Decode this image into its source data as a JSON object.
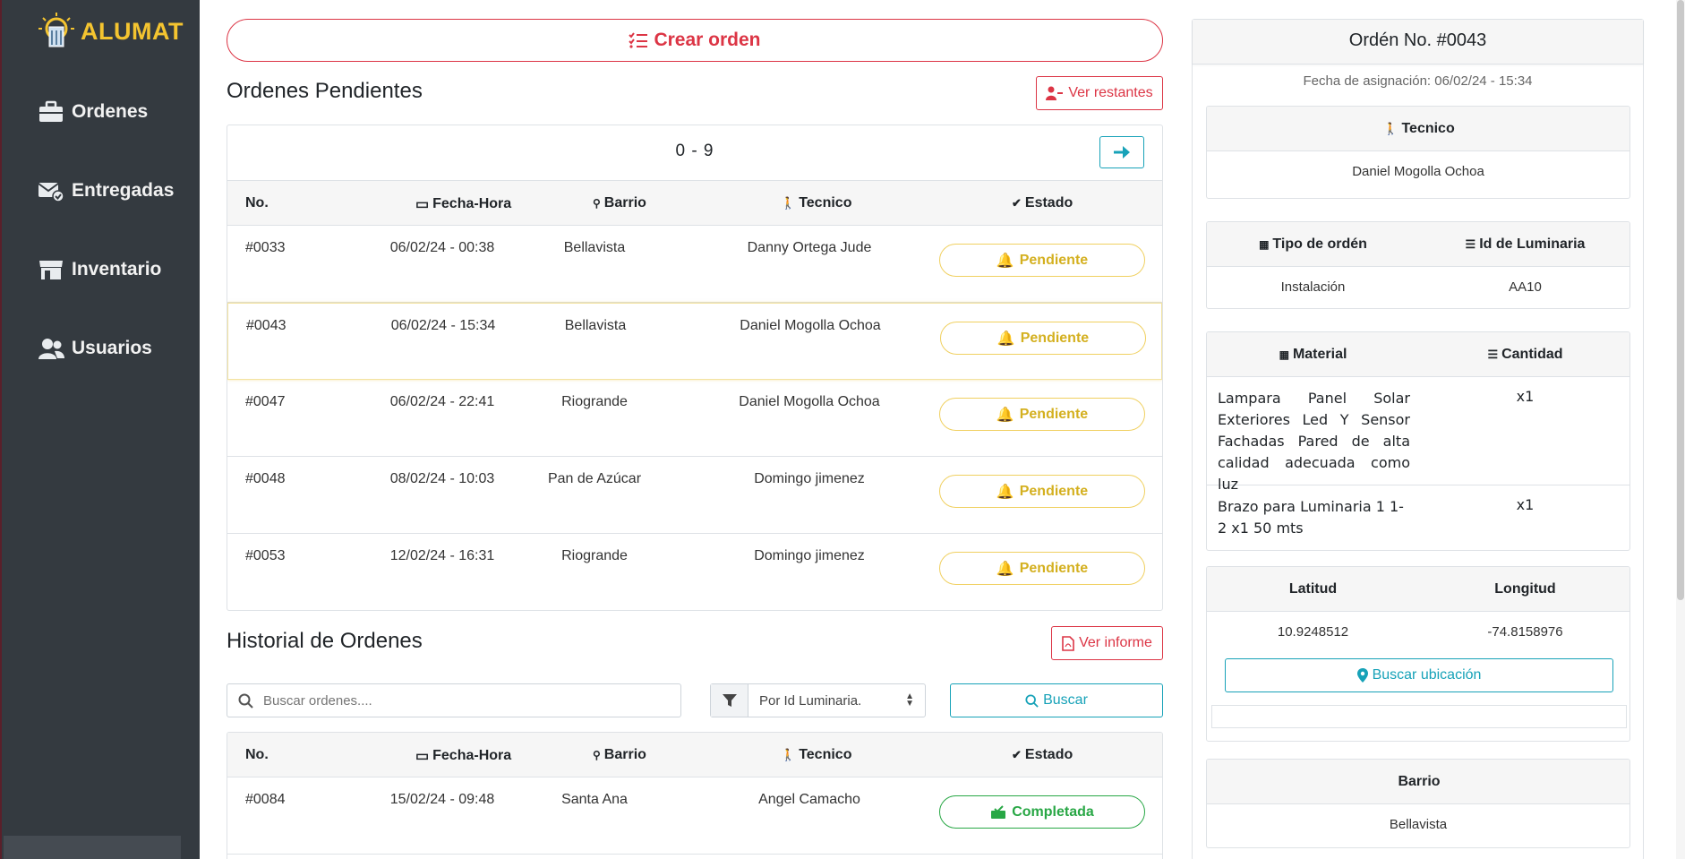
{
  "brand": {
    "name": "ALUMAT"
  },
  "sidebar": {
    "items": [
      {
        "label": "Ordenes",
        "icon": "briefcase-icon"
      },
      {
        "label": "Entregadas",
        "icon": "envelope-check-icon"
      },
      {
        "label": "Inventario",
        "icon": "store-icon"
      },
      {
        "label": "Usuarios",
        "icon": "users-icon"
      }
    ]
  },
  "main": {
    "create_label": "Crear orden",
    "pending": {
      "title": "Ordenes Pendientes",
      "ver_restantes": "Ver restantes",
      "range": "0 - 9",
      "headers": [
        "No.",
        "Fecha-Hora",
        "Barrio",
        "Tecnico",
        "Estado"
      ],
      "rows": [
        {
          "no": "#0033",
          "fecha": "06/02/24 - 00:38",
          "barrio": "Bellavista",
          "tecnico": "Danny Ortega Jude",
          "estado": "Pendiente"
        },
        {
          "no": "#0043",
          "fecha": "06/02/24 - 15:34",
          "barrio": "Bellavista",
          "tecnico": "Daniel Mogolla Ochoa",
          "estado": "Pendiente"
        },
        {
          "no": "#0047",
          "fecha": "06/02/24 - 22:41",
          "barrio": "Riogrande",
          "tecnico": "Daniel Mogolla Ochoa",
          "estado": "Pendiente"
        },
        {
          "no": "#0048",
          "fecha": "08/02/24 - 10:03",
          "barrio": "Pan de Azúcar",
          "tecnico": "Domingo jimenez",
          "estado": "Pendiente"
        },
        {
          "no": "#0053",
          "fecha": "12/02/24 - 16:31",
          "barrio": "Riogrande",
          "tecnico": "Domingo jimenez",
          "estado": "Pendiente"
        }
      ]
    },
    "history": {
      "title": "Historial de Ordenes",
      "ver_informe": "Ver informe",
      "search_placeholder": "Buscar ordenes....",
      "filter_selected": "Por Id Luminaria.",
      "search_button": "Buscar",
      "headers": [
        "No.",
        "Fecha-Hora",
        "Barrio",
        "Tecnico",
        "Estado"
      ],
      "rows": [
        {
          "no": "#0084",
          "fecha": "15/02/24 - 09:48",
          "barrio": "Santa Ana",
          "tecnico": "Angel Camacho",
          "estado": "Completada"
        }
      ]
    }
  },
  "detail": {
    "title": "Ordén No. #0043",
    "assigned": "Fecha de asignación: 06/02/24 - 15:34",
    "tecnico_label": "Tecnico",
    "tecnico_value": "Daniel Mogolla Ochoa",
    "tipo_label": "Tipo de ordén",
    "id_label": "Id de Luminaria",
    "tipo_value": "Instalación",
    "id_value": "AA10",
    "material_label": "Material",
    "cantidad_label": "Cantidad",
    "materials": [
      {
        "name": "Lampara Panel Solar Exteriores Led Y Sensor Fachadas Pared de alta calidad adecuada como luz",
        "qty": "x1"
      },
      {
        "name": "Brazo para Luminaria 1 1-2 x1 50 mts",
        "qty": "x1"
      }
    ],
    "lat_label": "Latitud",
    "lon_label": "Longitud",
    "lat_value": "10.9248512",
    "lon_value": "-74.8158976",
    "locate_button": "Buscar ubicación",
    "barrio_label": "Barrio",
    "barrio_value": "Bellavista"
  },
  "colors": {
    "sidebar": "#343a40",
    "accent_red": "#dc3545",
    "brand_yellow": "#f4c430",
    "pending": "#d4b020",
    "complete": "#28a745",
    "info": "#17a2b8"
  }
}
